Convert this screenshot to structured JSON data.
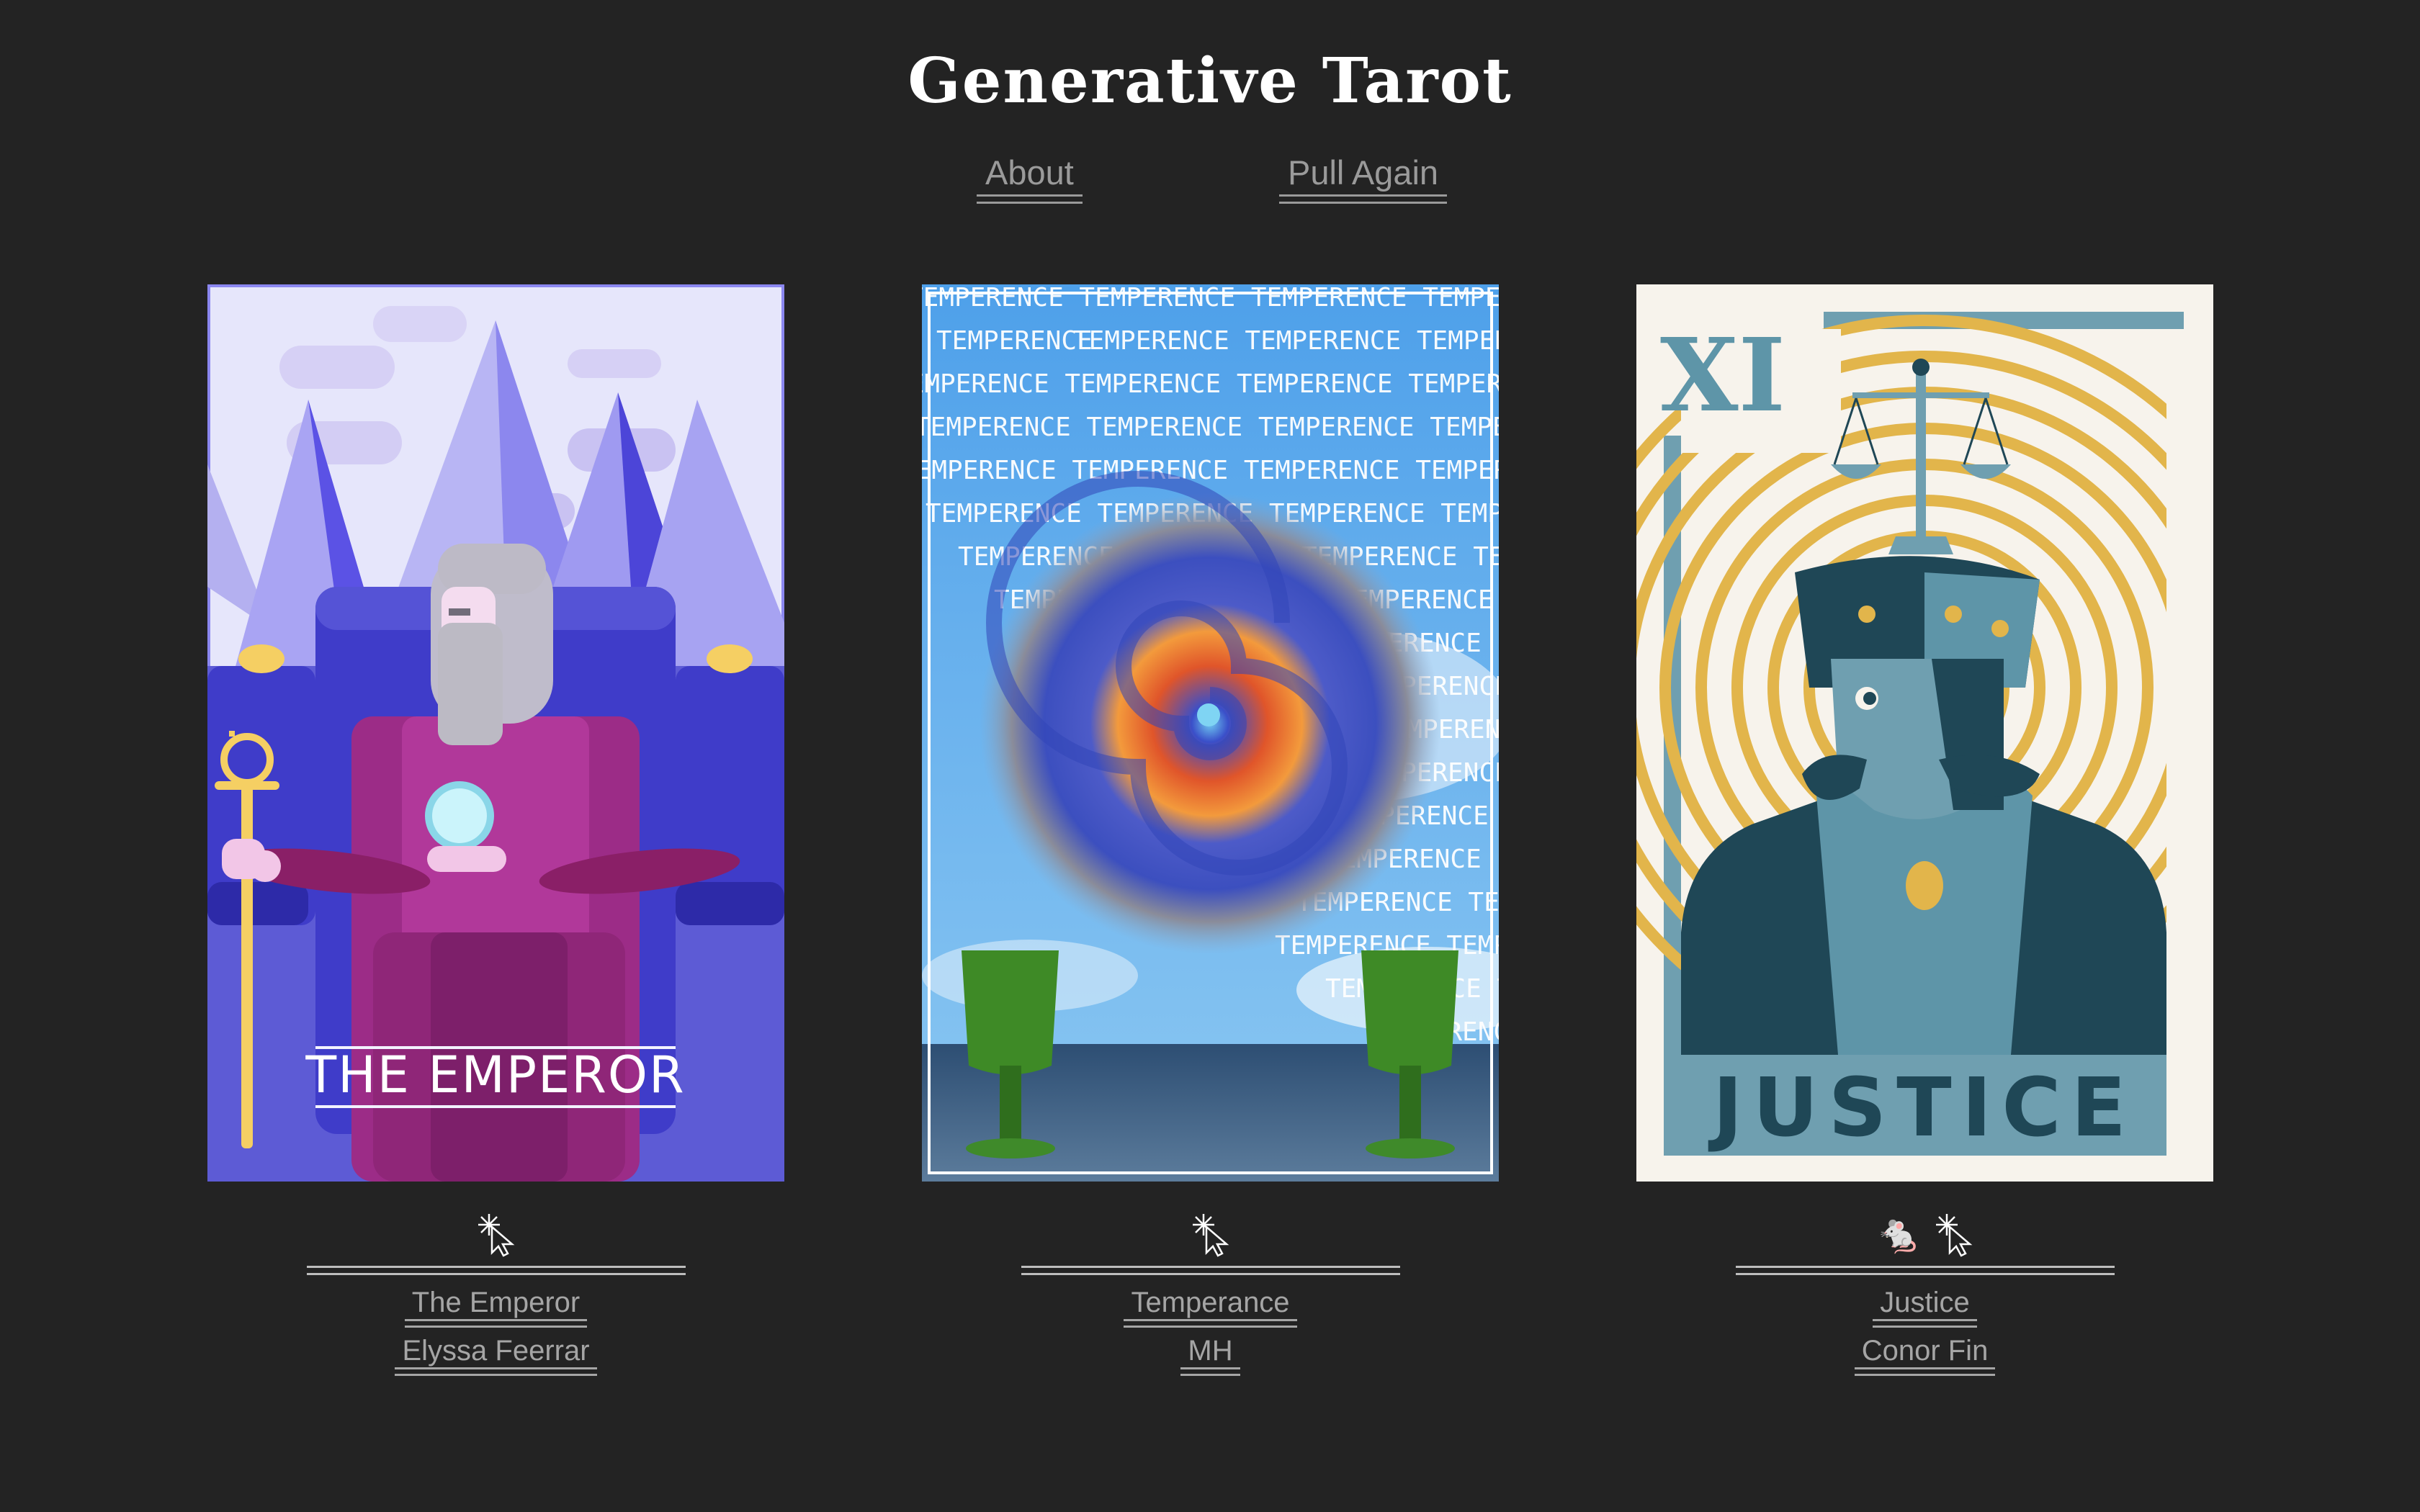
{
  "header": {
    "title": "Generative Tarot"
  },
  "nav": {
    "about": "About",
    "pull_again": "Pull Again"
  },
  "cards": [
    {
      "name": "The Emperor",
      "artist": "Elyssa Feerrar",
      "card_text": "THE EMPEROR",
      "icons": [
        "cursor-sparkle-icon"
      ]
    },
    {
      "name": "Temperance",
      "artist": "MH",
      "card_text": "TEMPERENCE",
      "icons": [
        "cursor-sparkle-icon"
      ]
    },
    {
      "name": "Justice",
      "artist": "Conor Fin",
      "card_text": "JUSTICE",
      "numeral": "XI",
      "icons": [
        "rat-icon",
        "cursor-sparkle-icon"
      ]
    }
  ],
  "colors": {
    "background": "#232323",
    "link": "#a5a5a5",
    "title": "#ffffff"
  }
}
